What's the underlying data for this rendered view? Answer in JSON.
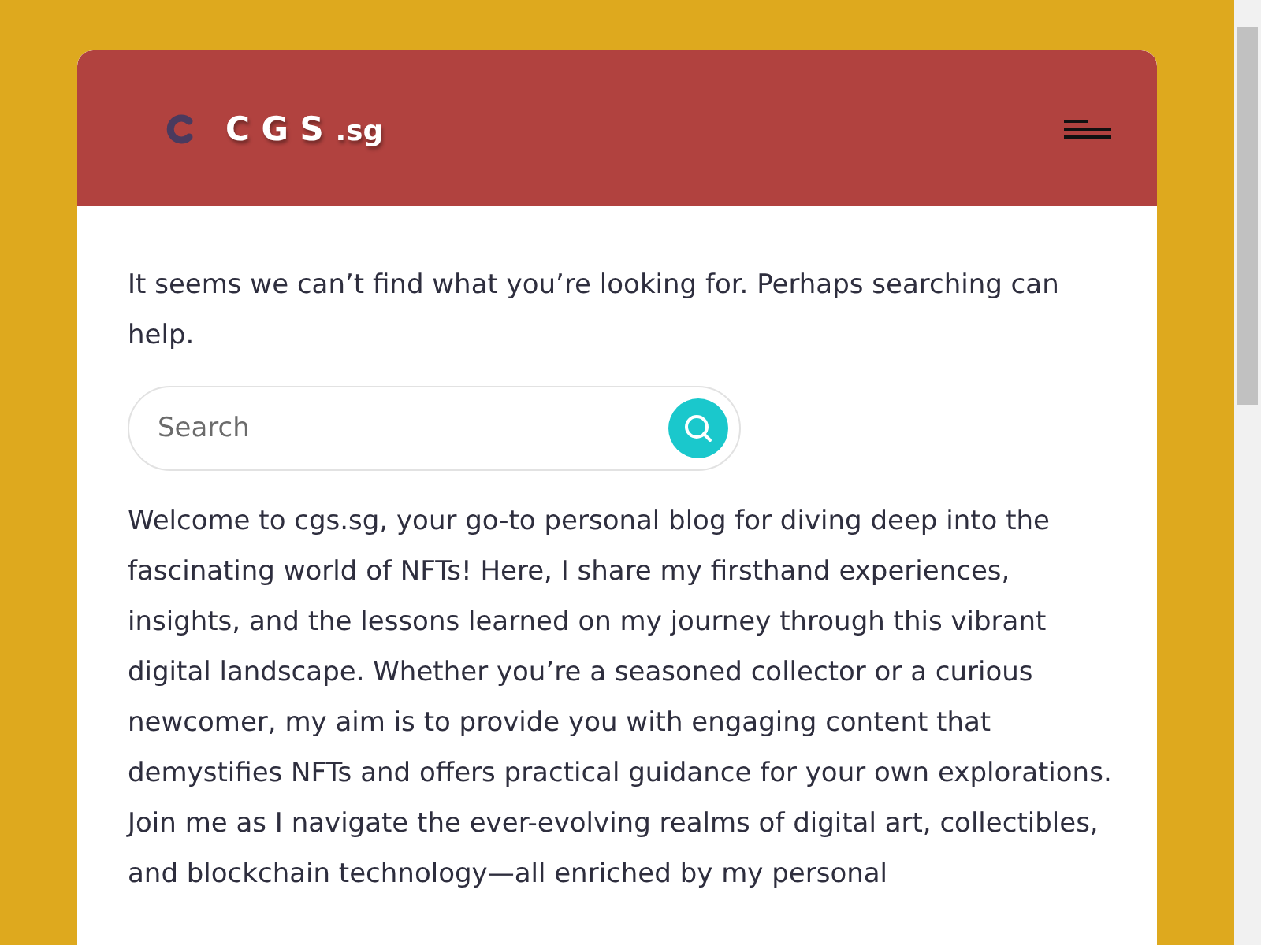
{
  "header": {
    "site_title": "C G S",
    "site_suffix": ".sg"
  },
  "not_found_message": "It seems we can’t find what you’re looking for. Perhaps searching can help.",
  "search": {
    "placeholder": "Search"
  },
  "paragraphs": [
    "Welcome to cgs.sg, your go-to personal blog for diving deep into the fascinating world of NFTs! Here, I share my firsthand experiences, insights, and the lessons learned on my journey through this vibrant digital landscape. Whether you’re a seasoned collector or a curious newcomer, my aim is to provide you with engaging content that demystifies NFTs and offers practical guidance for your own explorations.",
    "Join me as I navigate the ever-evolving realms of digital art, collectibles, and blockchain technology—all enriched by my personal"
  ]
}
